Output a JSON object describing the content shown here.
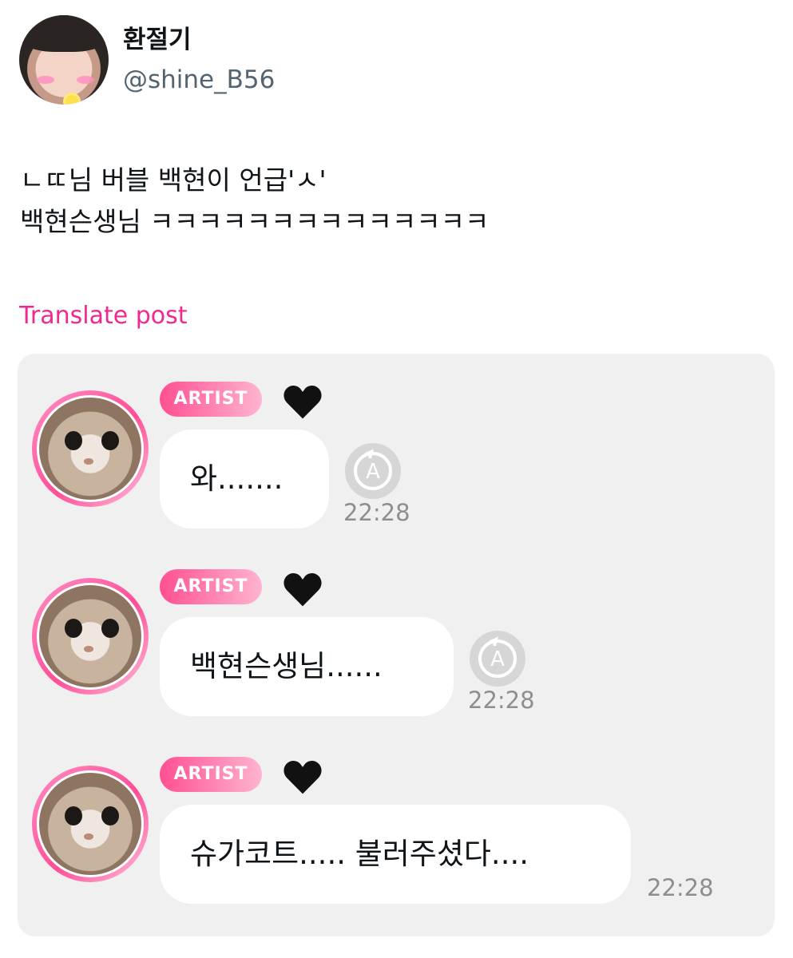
{
  "author": {
    "display_name": "환절기",
    "handle": "@shine_B56",
    "avatar_icon": "profile-avatar"
  },
  "post": {
    "text_line1": "ㄴㄸ님 버블 백현이 언급'ㅅ'",
    "text_line2": "백현슨생님 ㅋㅋㅋㅋㅋㅋㅋㅋㅋㅋㅋㅋㅋㅋ",
    "translate_label": "Translate post"
  },
  "chat": {
    "messages": [
      {
        "badge": "ARTIST",
        "heart_icon": "black-heart",
        "text": "와.......",
        "time": "22:28",
        "has_translate_icon": true
      },
      {
        "badge": "ARTIST",
        "heart_icon": "black-heart",
        "text": "백현슨생님......",
        "time": "22:28",
        "has_translate_icon": true
      },
      {
        "badge": "ARTIST",
        "heart_icon": "black-heart",
        "text": "슈가코트..... 불러주셨다....",
        "time": "22:28",
        "has_translate_icon": false
      }
    ]
  },
  "colors": {
    "accent_pink": "#f1288f",
    "card_bg": "#f0f0f0",
    "badge_gradient_start": "#ff4f92",
    "badge_gradient_end": "#ffb4d1"
  }
}
